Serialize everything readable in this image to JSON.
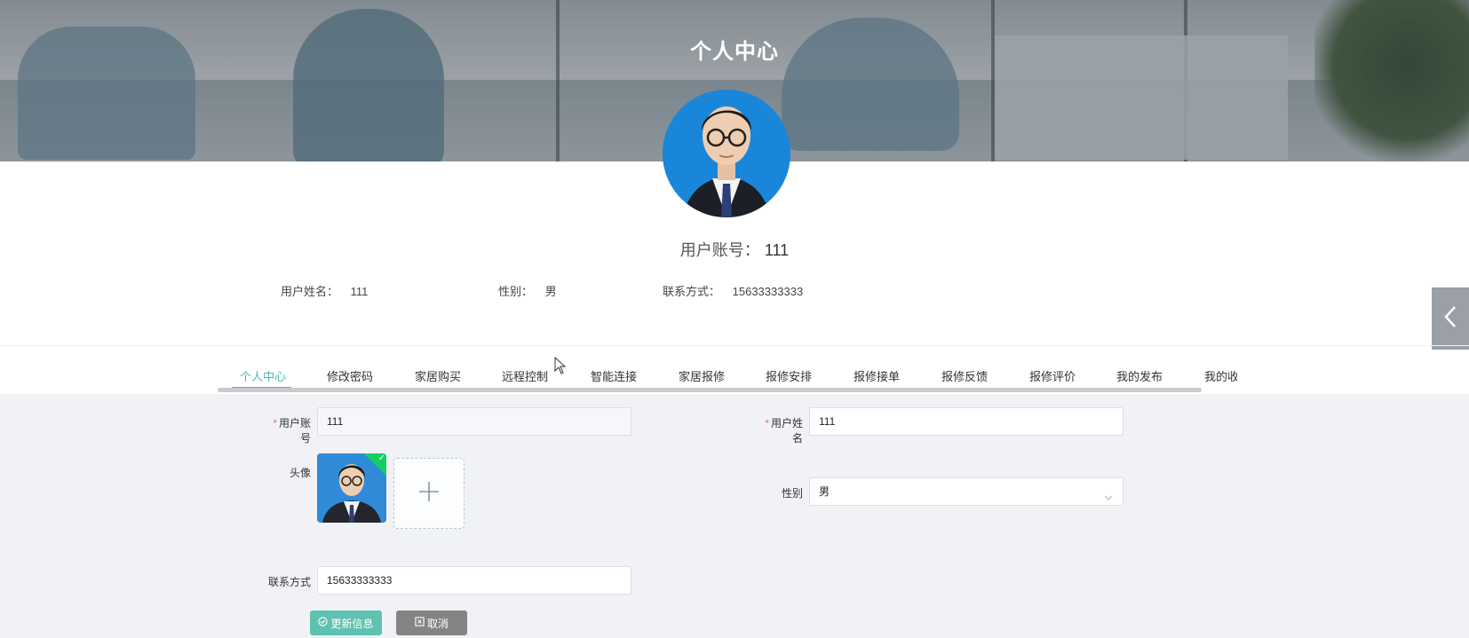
{
  "banner": {
    "title": "个人中心"
  },
  "profile": {
    "account_label": "用户账号：",
    "account_value": "111",
    "info": [
      {
        "label": "用户姓名：",
        "value": "111"
      },
      {
        "label": "性别：",
        "value": "男"
      },
      {
        "label": "联系方式：",
        "value": "15633333333"
      }
    ]
  },
  "tabs": [
    {
      "label": "个人中心",
      "active": true
    },
    {
      "label": "修改密码"
    },
    {
      "label": "家居购买"
    },
    {
      "label": "远程控制"
    },
    {
      "label": "智能连接"
    },
    {
      "label": "家居报修"
    },
    {
      "label": "报修安排"
    },
    {
      "label": "报修接单"
    },
    {
      "label": "报修反馈"
    },
    {
      "label": "报修评价"
    },
    {
      "label": "我的发布"
    },
    {
      "label": "我的收"
    }
  ],
  "form": {
    "account": {
      "label": "用户账号",
      "required_mark": "*",
      "value": "111"
    },
    "name": {
      "label": "用户姓名",
      "required_mark": "*",
      "value": "111"
    },
    "avatar": {
      "label": "头像"
    },
    "gender": {
      "label": "性别",
      "value": "男"
    },
    "phone": {
      "label": "联系方式",
      "value": "15633333333"
    },
    "update_button": "更新信息",
    "cancel_button": "取消"
  },
  "colors": {
    "accent": "#4bb8b0",
    "primary_button": "#5fc2b0",
    "cancel_button": "#848484",
    "required": "#f56c6c"
  },
  "icons": {
    "side_toggle": "chevron-left-icon",
    "upload": "plus-icon",
    "select": "chevron-down-icon",
    "update": "check-circle-icon",
    "cancel": "close-square-icon"
  }
}
